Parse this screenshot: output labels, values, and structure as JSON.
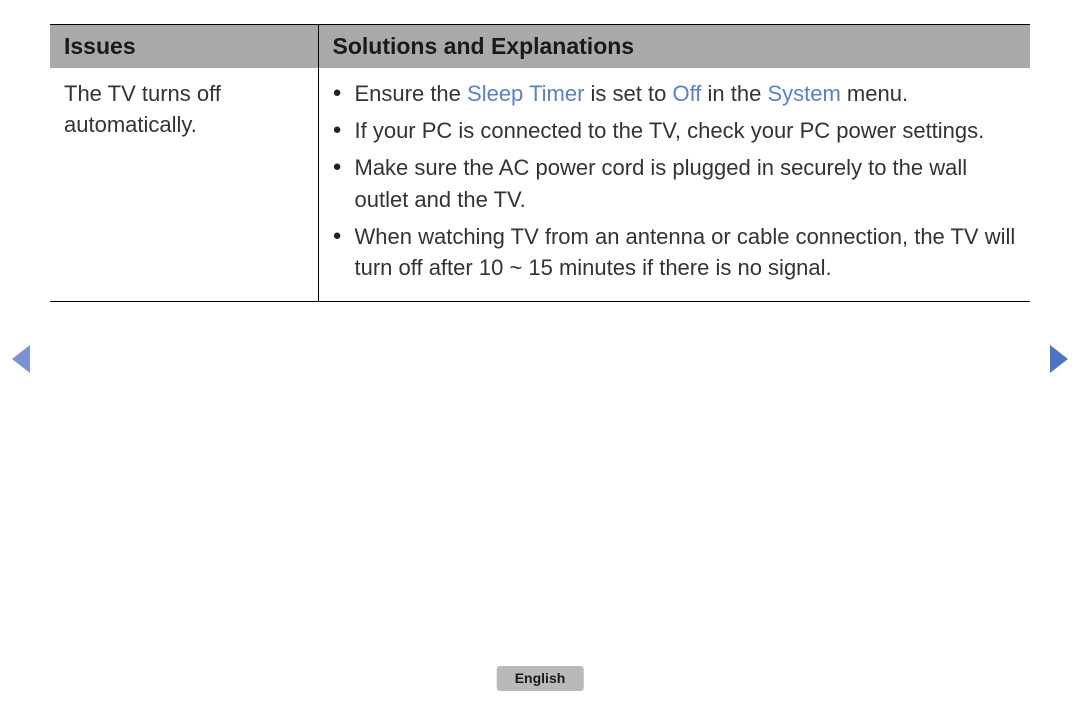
{
  "table": {
    "headers": {
      "issues": "Issues",
      "solutions": "Solutions and Explanations"
    },
    "row": {
      "issue": "The TV turns off automatically.",
      "solutions": [
        {
          "segments": [
            {
              "text": "Ensure the "
            },
            {
              "text": "Sleep Timer",
              "highlight": true
            },
            {
              "text": " is set to "
            },
            {
              "text": "Off",
              "highlight": true
            },
            {
              "text": " in the "
            },
            {
              "text": "System",
              "highlight": true
            },
            {
              "text": " menu."
            }
          ]
        },
        {
          "segments": [
            {
              "text": "If your PC is connected to the TV, check your PC power settings."
            }
          ]
        },
        {
          "segments": [
            {
              "text": "Make sure the AC power cord is plugged in securely to the wall outlet and the TV."
            }
          ]
        },
        {
          "segments": [
            {
              "text": "When watching TV from an antenna or cable connection, the TV will turn off after 10 ~ 15 minutes if there is no signal."
            }
          ]
        }
      ]
    }
  },
  "footer": {
    "language": "English"
  }
}
